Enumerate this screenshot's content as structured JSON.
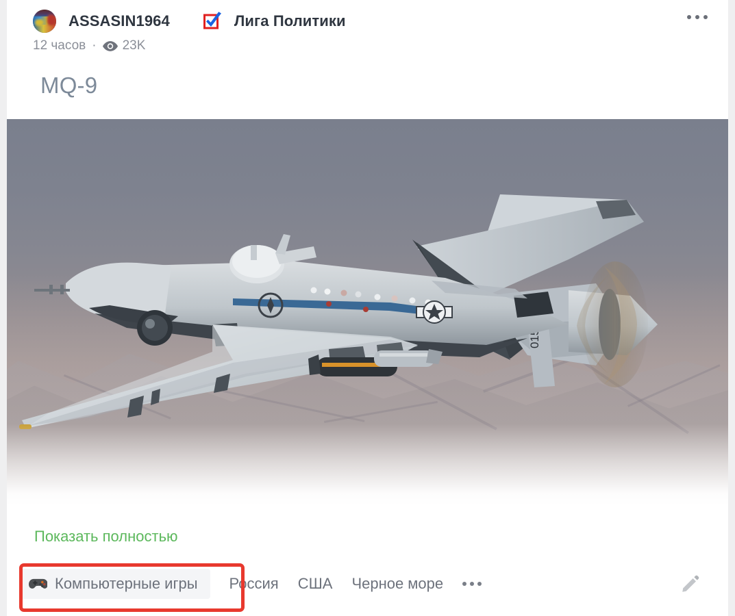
{
  "post": {
    "author": {
      "name": "ASSASIN1964",
      "avatar_icon": "user-avatar-photo"
    },
    "community": {
      "name": "Лига Политики",
      "icon": "verified-checkbox-icon"
    },
    "meta": {
      "time": "12 часов",
      "separator": "·",
      "views_icon": "eye-icon",
      "views": "23K"
    },
    "menu_icon": "more-horizontal-icon",
    "title": "MQ-9",
    "media": {
      "icon": "drone-photo",
      "alt": "MQ-9 Reaper drone flying over mountains"
    },
    "show_full_label": "Показать полностью",
    "tags": [
      {
        "label": "Компьютерные игры",
        "icon": "gamepad-icon",
        "highlighted": true
      },
      {
        "label": "Россия",
        "icon": null,
        "highlighted": false
      },
      {
        "label": "США",
        "icon": null,
        "highlighted": false
      },
      {
        "label": "Черное море",
        "icon": null,
        "highlighted": false
      }
    ],
    "tags_more_icon": "more-horizontal-icon",
    "edit_icon": "pencil-icon"
  },
  "colors": {
    "link_green": "#5cb85c",
    "title_gray": "#7d8a99",
    "text_gray": "#6d727c",
    "meta_gray": "#8b8f98",
    "annotation_red": "#e8392e",
    "tag_pill_bg": "#f4f5f7",
    "page_bg": "#efeff0",
    "card_bg": "#ffffff"
  }
}
